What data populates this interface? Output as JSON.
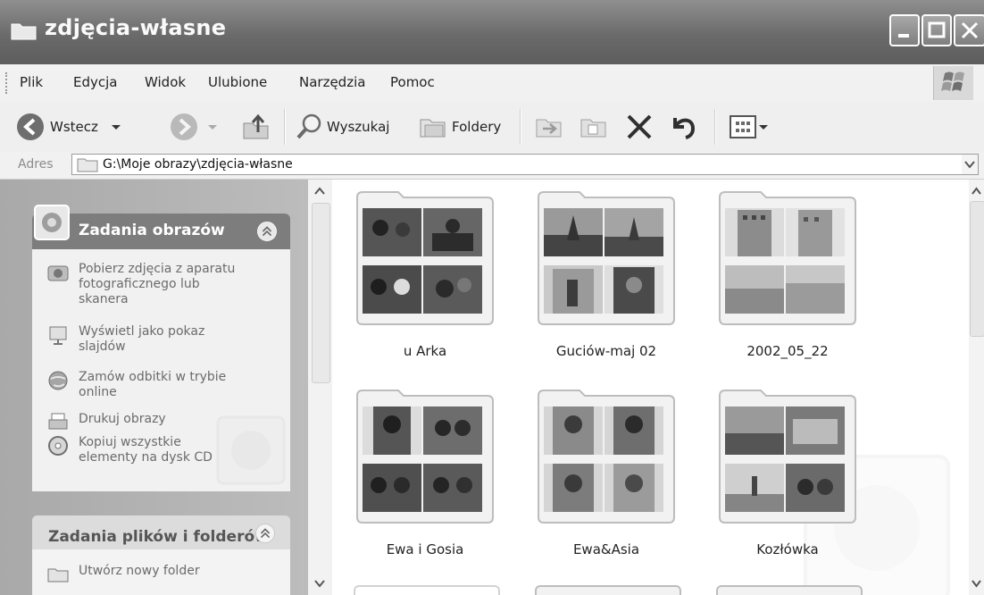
{
  "window": {
    "title": "zdjęcia-własne"
  },
  "menu": [
    "Plik",
    "Edycja",
    "Widok",
    "Ulubione",
    "Narzędzia",
    "Pomoc"
  ],
  "toolbar": {
    "back_label": "Wstecz",
    "search_label": "Wyszukaj",
    "folders_label": "Foldery"
  },
  "address": {
    "label": "Adres",
    "path": "G:\\Moje obrazy\\zdjęcia-własne"
  },
  "picture_tasks": {
    "title": "Zadania obrazów",
    "items": [
      {
        "label": "Pobierz zdjęcia z aparatu\nfotograficznego lub\nskanera",
        "icon": "camera-icon"
      },
      {
        "label": "Wyświetl jako pokaz\nslajdów",
        "icon": "slideshow-icon"
      },
      {
        "label": "Zamów odbitki w trybie\nonline",
        "icon": "globe-icon"
      },
      {
        "label": "Drukuj obrazy",
        "icon": "print-icon"
      },
      {
        "label": "Kopiuj wszystkie\nelementy na dysk CD",
        "icon": "cd-icon"
      }
    ]
  },
  "file_tasks": {
    "title": "Zadania plików i folderów",
    "items": [
      {
        "label": "Utwórz nowy folder",
        "icon": "new-folder-icon"
      }
    ]
  },
  "folders": [
    {
      "name": "u Arka"
    },
    {
      "name": "Guciów-maj 02"
    },
    {
      "name": "2002_05_22"
    },
    {
      "name": "Ewa i Gosia"
    },
    {
      "name": "Ewa&Asia"
    },
    {
      "name": "Kozłówka"
    }
  ]
}
